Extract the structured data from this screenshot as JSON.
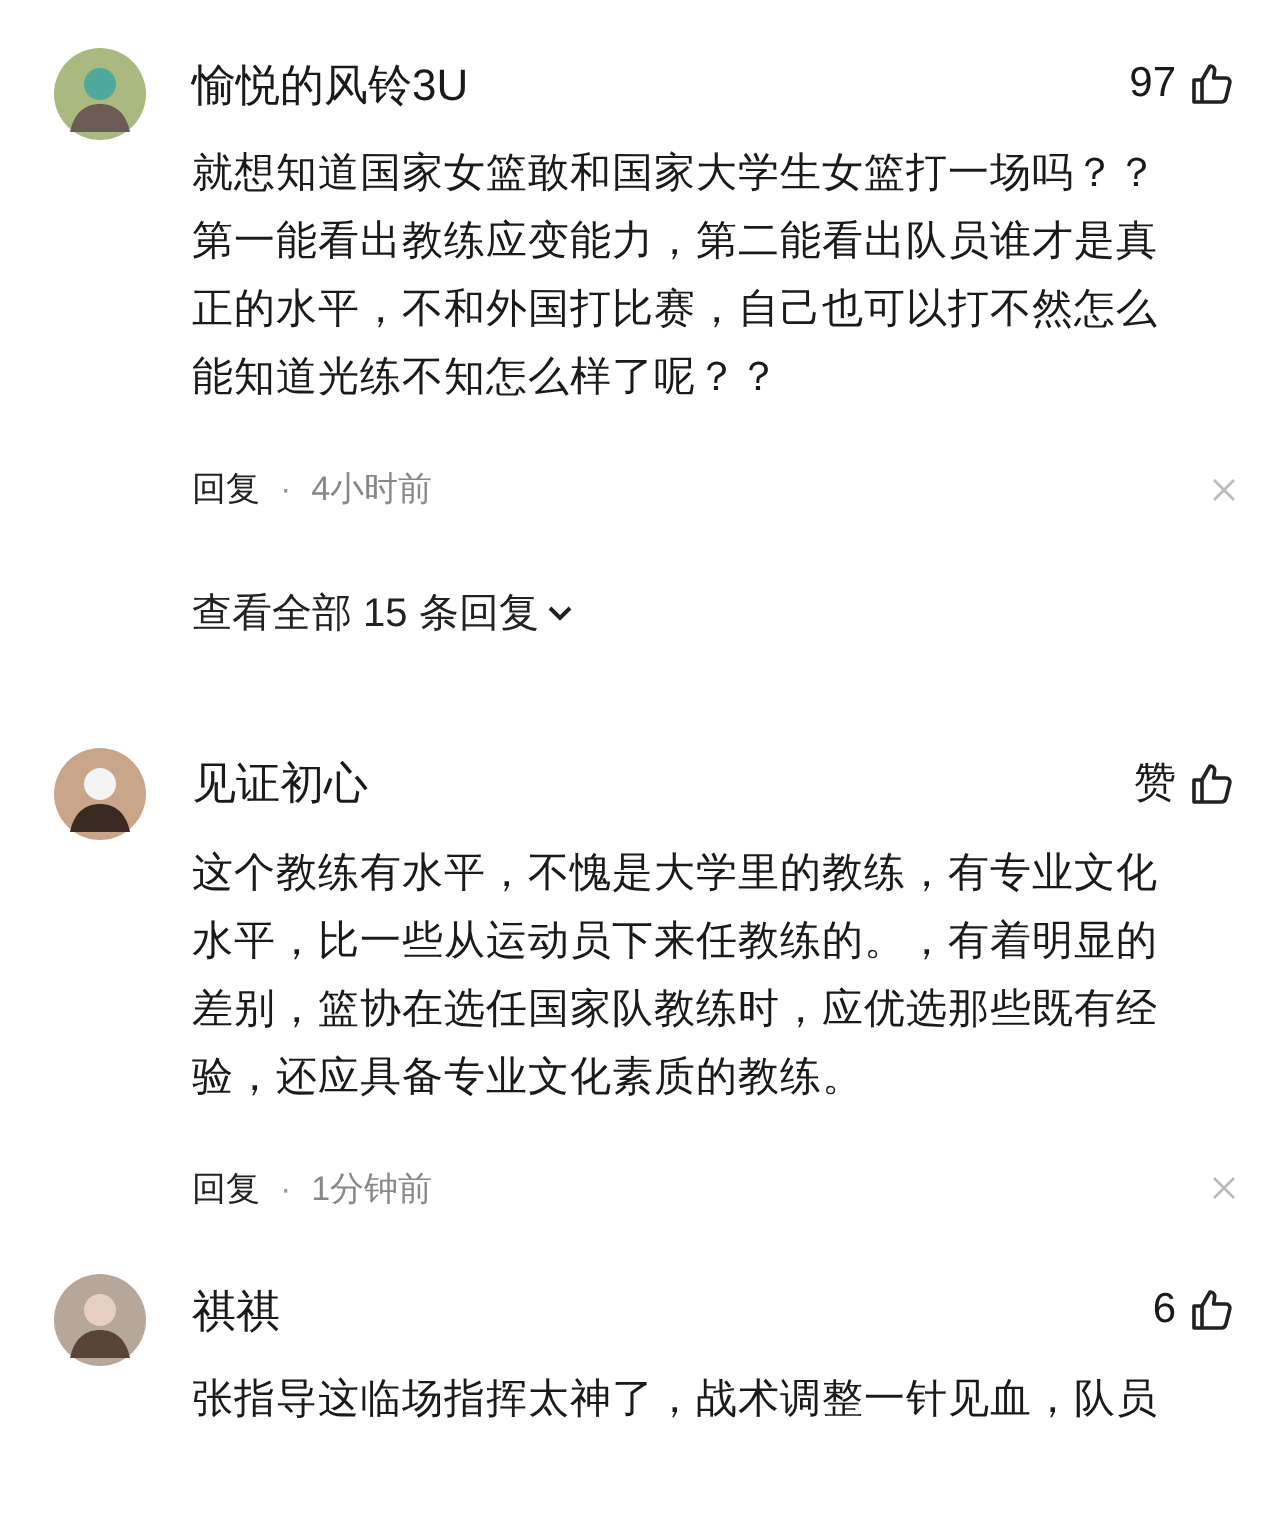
{
  "comments": [
    {
      "name": "愉悦的风铃3U",
      "likes": "97",
      "text": "就想知道国家女篮敢和国家大学生女篮打一场吗？？第一能看出教练应变能力，第二能看出队员谁才是真正的水平，不和外国打比赛，自己也可以打不然怎么能知道光练不知怎么样了呢？？",
      "reply": "回复",
      "separator": "·",
      "time": "4小时前",
      "view_replies": "查看全部 15 条回复"
    },
    {
      "name": "见证初心",
      "likes": "赞",
      "text": "这个教练有水平，不愧是大学里的教练，有专业文化水平，比一些从运动员下来任教练的。，有着明显的差别，篮协在选任国家队教练时，应优选那些既有经验，还应具备专业文化素质的教练。",
      "reply": "回复",
      "separator": "·",
      "time": "1分钟前"
    },
    {
      "name": "祺祺",
      "likes": "6",
      "text": "张指导这临场指挥太神了，战术调整一针见血，队员"
    }
  ]
}
